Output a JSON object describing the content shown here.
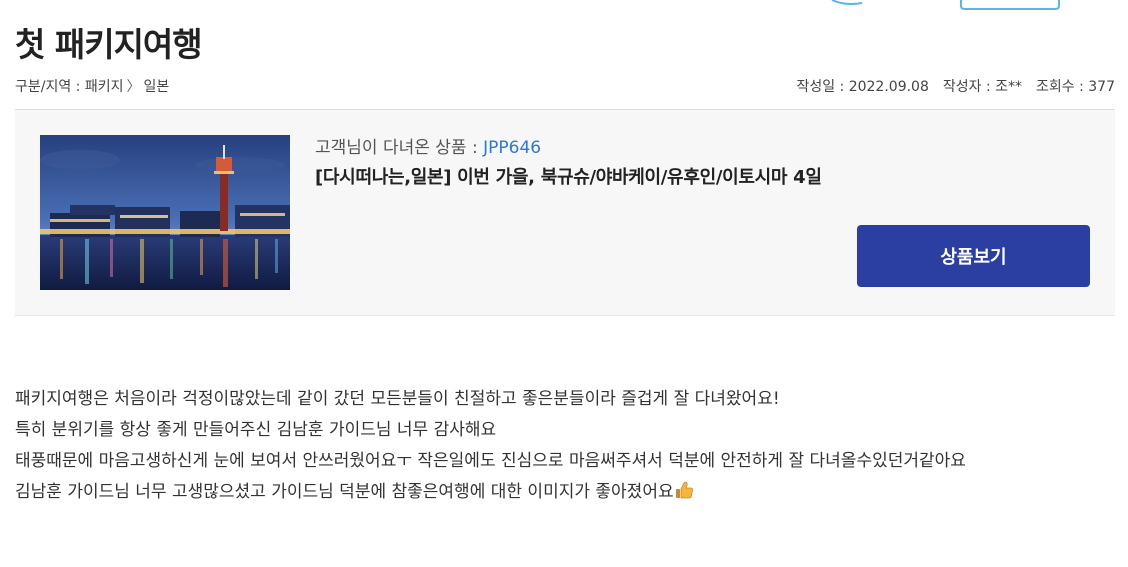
{
  "post": {
    "title": "첫 패키지여행",
    "category_label": "구분/지역 : 패키지",
    "category_separator": "〉",
    "region": "일본",
    "date": "작성일 : 2022.09.08",
    "author": "작성자 : 조**",
    "views": "조회수 : 377"
  },
  "product": {
    "code_label": "고객님이 다녀온 상품 : ",
    "code": "JPP646",
    "name": "[다시떠나는,일본] 이번 가을, 북규슈/야바케이/유후인/이토시마 4일",
    "view_button_label": "상품보기",
    "thumbnail_icon": "night-harbor-tower-photo"
  },
  "review": {
    "lines": [
      "패키지여행은 처음이라 걱정이많았는데 같이 갔던 모든분들이 친절하고 좋은분들이라 즐겁게 잘 다녀왔어요!",
      "특히 분위기를 항상 좋게 만들어주신 김남훈 가이드님 너무 감사해요",
      "태풍때문에 마음고생하신게 눈에 보여서 안쓰러웠어요ㅜ 작은일에도 진심으로 마음써주셔서 덕분에 안전하게 잘 다녀올수있던거같아요",
      "김남훈 가이드님 너무 고생많으셨고 가이드님 덕분에 참좋은여행에 대한 이미지가 좋아졌어요"
    ],
    "emoji_icon": "thumbs-up-icon"
  },
  "colors": {
    "accent_link": "#2b79d8",
    "button_bg": "#2b3ea1",
    "box_bg": "#f7f7f7"
  }
}
